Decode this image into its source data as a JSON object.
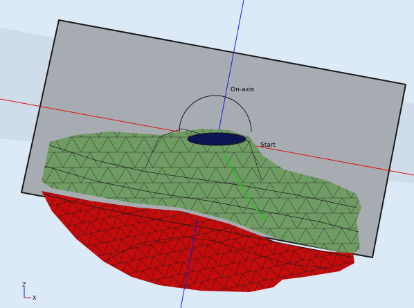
{
  "viewport": {
    "background_color": "#dce9f7",
    "section_plane_color": "#a7acb2",
    "upper_body_color": "#6a9a5c",
    "lower_body_color": "#c40c0c",
    "mesh_edge_color": "#2a2a2a",
    "dome_top_color": "#0d1550",
    "x_axis_color": "#e01010",
    "z_axis_color": "#1a1ae0",
    "path_color": "#20c020"
  },
  "annotations": {
    "on_axis_label": "On-axis",
    "start_label": "Start"
  },
  "triad": {
    "z_label": "Z",
    "x_label": "X",
    "icon": "xz-axis-triad-icon"
  }
}
